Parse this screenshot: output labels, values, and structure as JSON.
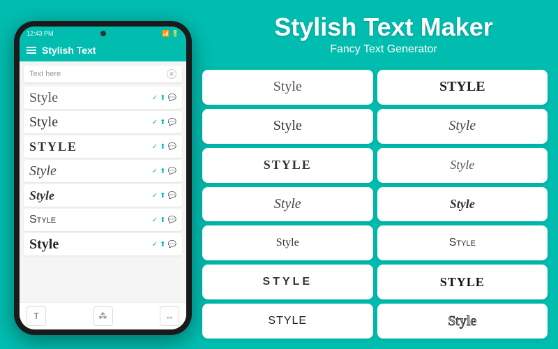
{
  "app": {
    "title": "Stylish Text Maker",
    "subtitle": "Fancy Text Generator",
    "bar_title": "Stylish Text",
    "search_placeholder": "Text here"
  },
  "status_bar": {
    "time": "12:43 PM",
    "signal": "▲▼",
    "battery": "■■■"
  },
  "phone": {
    "list_items": [
      {
        "text": "Style",
        "font_class": "font-serif"
      },
      {
        "text": "Style",
        "font_class": "font-cursive"
      },
      {
        "text": "STYLE",
        "font_class": "font-gothic"
      },
      {
        "text": "Style",
        "font_class": "font-thin"
      },
      {
        "text": "Style",
        "font_class": "font-script"
      },
      {
        "text": "Style",
        "font_class": "font-small-caps"
      },
      {
        "text": "Style",
        "font_class": "font-bold-serif"
      }
    ]
  },
  "grid_items": [
    {
      "text": "Style",
      "font_class": "font-serif"
    },
    {
      "text": "STYLE",
      "font_class": "font-bold-serif"
    },
    {
      "text": "Style",
      "font_class": "font-cursive"
    },
    {
      "text": "Style",
      "font_class": "font-thin"
    },
    {
      "text": "STYLE",
      "font_class": "font-gothic"
    },
    {
      "text": "Style",
      "font_class": "font-elegant"
    },
    {
      "text": "Style",
      "font_class": "font-fancy"
    },
    {
      "text": "Style",
      "font_class": "font-script"
    },
    {
      "text": "Style",
      "font_class": "font-hand"
    },
    {
      "text": "Style",
      "font_class": "font-small-caps"
    },
    {
      "text": "STYLE",
      "font_class": "font-wide"
    },
    {
      "text": "STYLE",
      "font_class": "font-stencil"
    },
    {
      "text": "STYLE",
      "font_class": "font-blackletter"
    },
    {
      "text": "Style",
      "font_class": "font-outline"
    }
  ]
}
